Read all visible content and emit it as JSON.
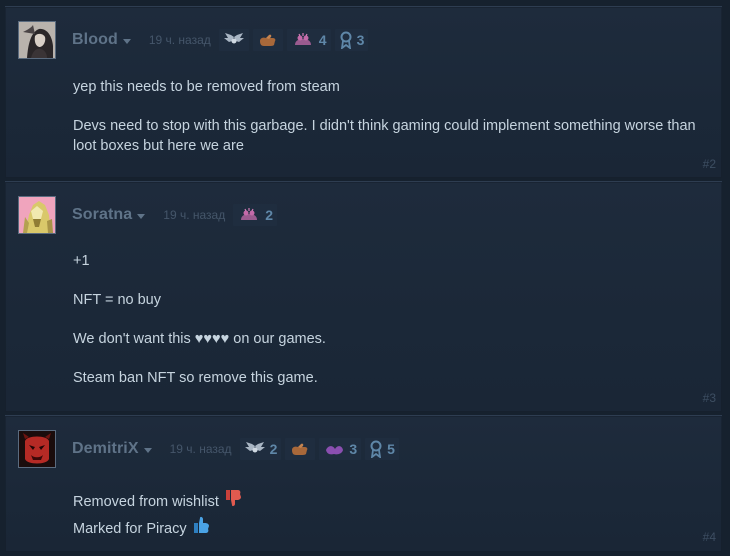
{
  "comments": [
    {
      "author": "Blood",
      "timestamp": "19 ч. назад",
      "awards": [
        {
          "icon": "wings-award-icon",
          "count": ""
        },
        {
          "icon": "hand-award-icon",
          "count": ""
        },
        {
          "icon": "clap-award-icon",
          "count": "4"
        },
        {
          "icon": "ribbon-award-icon",
          "count": "3"
        }
      ],
      "paragraphs": [
        "yep this needs to be removed from steam",
        "Devs need to stop with this garbage. I didn't think gaming could implement something worse than loot boxes but here we are"
      ],
      "post_number": "#2"
    },
    {
      "author": "Soratna",
      "timestamp": "19 ч. назад",
      "awards": [
        {
          "icon": "clap-award-icon",
          "count": "2"
        }
      ],
      "paragraphs": [
        "+1",
        "NFT = no buy",
        "We don't want this ♥♥♥♥ on our games.",
        "Steam ban NFT so remove this game."
      ],
      "post_number": "#3"
    },
    {
      "author": "DemitriX",
      "timestamp": "19 ч. назад",
      "awards": [
        {
          "icon": "wings-award-icon",
          "count": "2"
        },
        {
          "icon": "hand-award-icon",
          "count": ""
        },
        {
          "icon": "clap-award-icon",
          "count": "3"
        },
        {
          "icon": "ribbon-award-icon",
          "count": "5"
        }
      ],
      "lines": [
        {
          "text": "Removed from wishlist",
          "emoji": "thumbs-down-icon"
        },
        {
          "text": "Marked for Piracy",
          "emoji": "thumbs-up-icon"
        }
      ],
      "post_number": "#4"
    }
  ],
  "colors": {
    "background": "#16212e",
    "author": "#5f7388",
    "text": "#c6d4df",
    "award_count": "#5f87a8"
  }
}
